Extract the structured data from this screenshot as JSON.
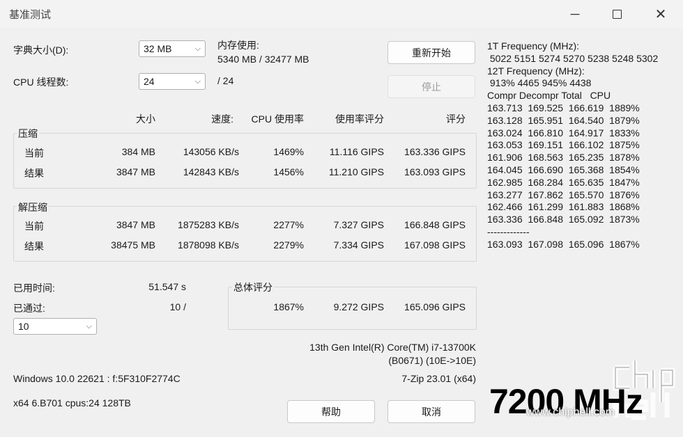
{
  "window": {
    "title": "基准测试"
  },
  "dict": {
    "label": "字典大小(D):",
    "value": "32 MB"
  },
  "threads": {
    "label": "CPU 线程数:",
    "value": "24",
    "max": "/ 24"
  },
  "memory": {
    "label": "内存使用:",
    "value": "5340 MB / 32477 MB"
  },
  "buttons": {
    "restart": "重新开始",
    "stop": "停止",
    "help": "帮助",
    "cancel": "取消"
  },
  "columns": {
    "size": "大小",
    "speed": "速度:",
    "cpu_usage": "CPU 使用率",
    "rating_usage": "使用率评分",
    "rating": "评分"
  },
  "compress": {
    "title": "压缩",
    "rows": [
      {
        "label": "当前",
        "size": "384 MB",
        "speed": "143056 KB/s",
        "cpu": "1469%",
        "usage_rating": "11.116 GIPS",
        "rating": "163.336 GIPS"
      },
      {
        "label": "结果",
        "size": "3847 MB",
        "speed": "142843 KB/s",
        "cpu": "1456%",
        "usage_rating": "11.210 GIPS",
        "rating": "163.093 GIPS"
      }
    ]
  },
  "decompress": {
    "title": "解压缩",
    "rows": [
      {
        "label": "当前",
        "size": "3847 MB",
        "speed": "1875283 KB/s",
        "cpu": "2277%",
        "usage_rating": "7.327 GIPS",
        "rating": "166.848 GIPS"
      },
      {
        "label": "结果",
        "size": "38475 MB",
        "speed": "1878098 KB/s",
        "cpu": "2279%",
        "usage_rating": "7.334 GIPS",
        "rating": "167.098 GIPS"
      }
    ]
  },
  "elapsed": {
    "label": "已用时间:",
    "value": "51.547 s"
  },
  "passed": {
    "label": "已通过:",
    "value": "10 /"
  },
  "passes_select": {
    "value": "10"
  },
  "total": {
    "title": "总体评分",
    "cpu": "1867%",
    "usage_rating": "9.272 GIPS",
    "rating": "165.096 GIPS"
  },
  "cpu_info": {
    "line1": "13th Gen Intel(R) Core(TM) i7-13700K",
    "line2": "(B0671) (10E->10E)"
  },
  "os_info": "Windows 10.0 22621 :  f:5F310F2774C",
  "version": "7-Zip 23.01 (x64)",
  "arch_info": "x64 6.B701 cpus:24 128TB",
  "right_panel": [
    "1T Frequency (MHz):",
    " 5022 5151 5274 5270 5238 5248 5302",
    "12T Frequency (MHz):",
    " 913% 4465 945% 4438",
    "Compr Decompr Total   CPU",
    "163.713  169.525  166.619  1889%",
    "163.128  165.951  164.540  1879%",
    "163.024  166.810  164.917  1833%",
    "163.053  169.151  166.102  1875%",
    "161.906  168.563  165.235  1878%",
    "164.045  166.690  165.368  1854%",
    "162.985  168.284  165.635  1847%",
    "163.277  167.862  165.570  1876%",
    "162.466  161.299  161.883  1868%",
    "163.336  166.848  165.092  1873%",
    "-------------",
    "163.093  167.098  165.096  1867%"
  ],
  "watermark": {
    "mhz": "7200 MHz",
    "site": "www.chiphell.com",
    "logo": "chip hell"
  },
  "icons": {
    "minimize": "minimize-icon",
    "maximize": "maximize-icon",
    "close": "close-icon",
    "dropdown": "chevron-down-icon"
  }
}
